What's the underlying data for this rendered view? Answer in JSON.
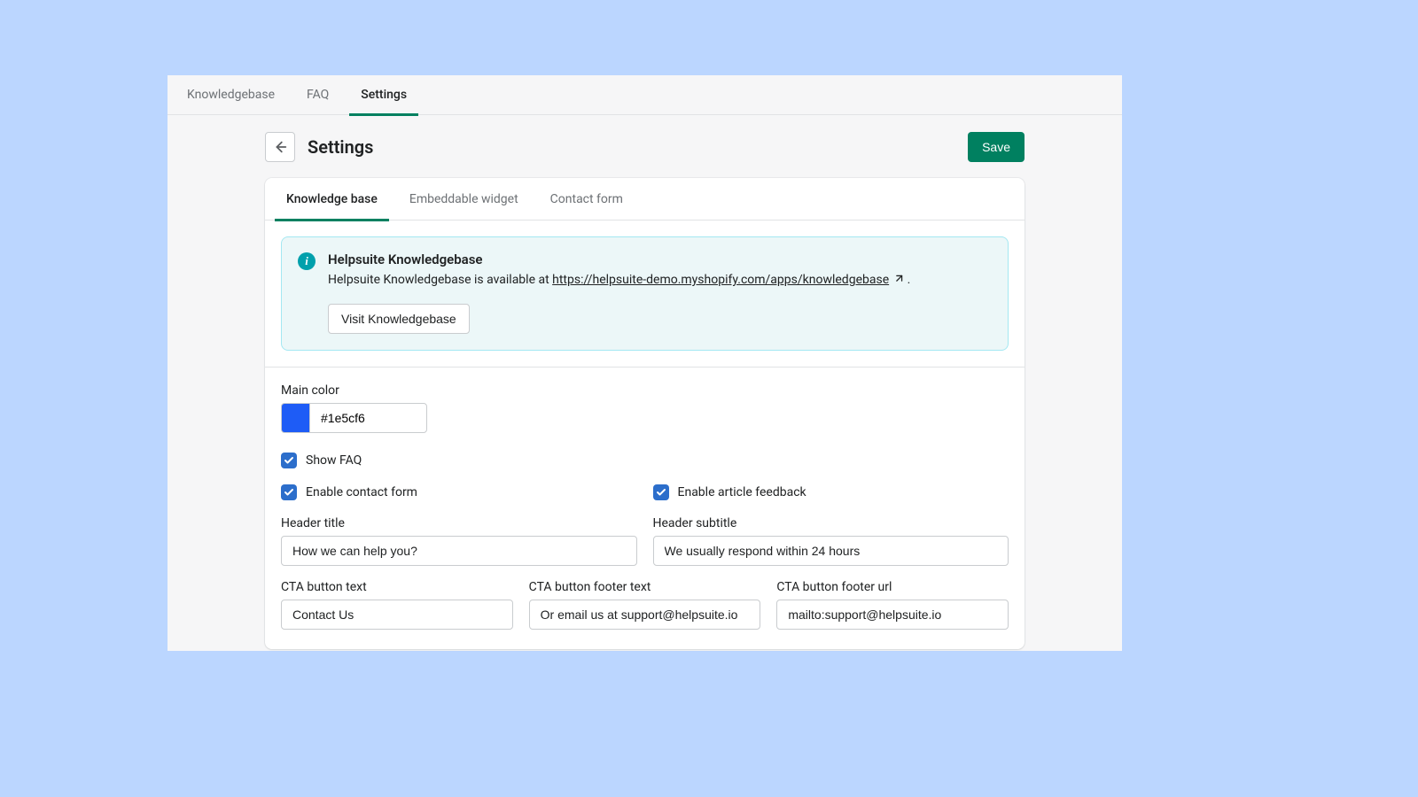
{
  "topnav": {
    "items": [
      "Knowledgebase",
      "FAQ",
      "Settings"
    ],
    "active_index": 2
  },
  "page": {
    "title": "Settings",
    "save_label": "Save"
  },
  "inner_tabs": {
    "items": [
      "Knowledge base",
      "Embeddable widget",
      "Contact form"
    ],
    "active_index": 0
  },
  "banner": {
    "title": "Helpsuite Knowledgebase",
    "text_prefix": "Helpsuite Knowledgebase is available at ",
    "link_text": "https://helpsuite-demo.myshopify.com/apps/knowledgebase",
    "text_suffix": " .",
    "visit_label": "Visit Knowledgebase"
  },
  "form": {
    "main_color_label": "Main color",
    "main_color_value": "#1e5cf6",
    "show_faq_label": "Show FAQ",
    "show_faq_checked": true,
    "enable_contact_label": "Enable contact form",
    "enable_contact_checked": true,
    "enable_feedback_label": "Enable article feedback",
    "enable_feedback_checked": true,
    "header_title_label": "Header title",
    "header_title_value": "How we can help you?",
    "header_subtitle_label": "Header subtitle",
    "header_subtitle_value": "We usually respond within 24 hours",
    "cta_text_label": "CTA button text",
    "cta_text_value": "Contact Us",
    "cta_footer_text_label": "CTA button footer text",
    "cta_footer_text_value": "Or email us at support@helpsuite.io",
    "cta_footer_url_label": "CTA button footer url",
    "cta_footer_url_value": "mailto:support@helpsuite.io"
  },
  "colors": {
    "accent": "#008060",
    "checkbox": "#2c6ecb",
    "swatch": "#1e5cf6"
  }
}
